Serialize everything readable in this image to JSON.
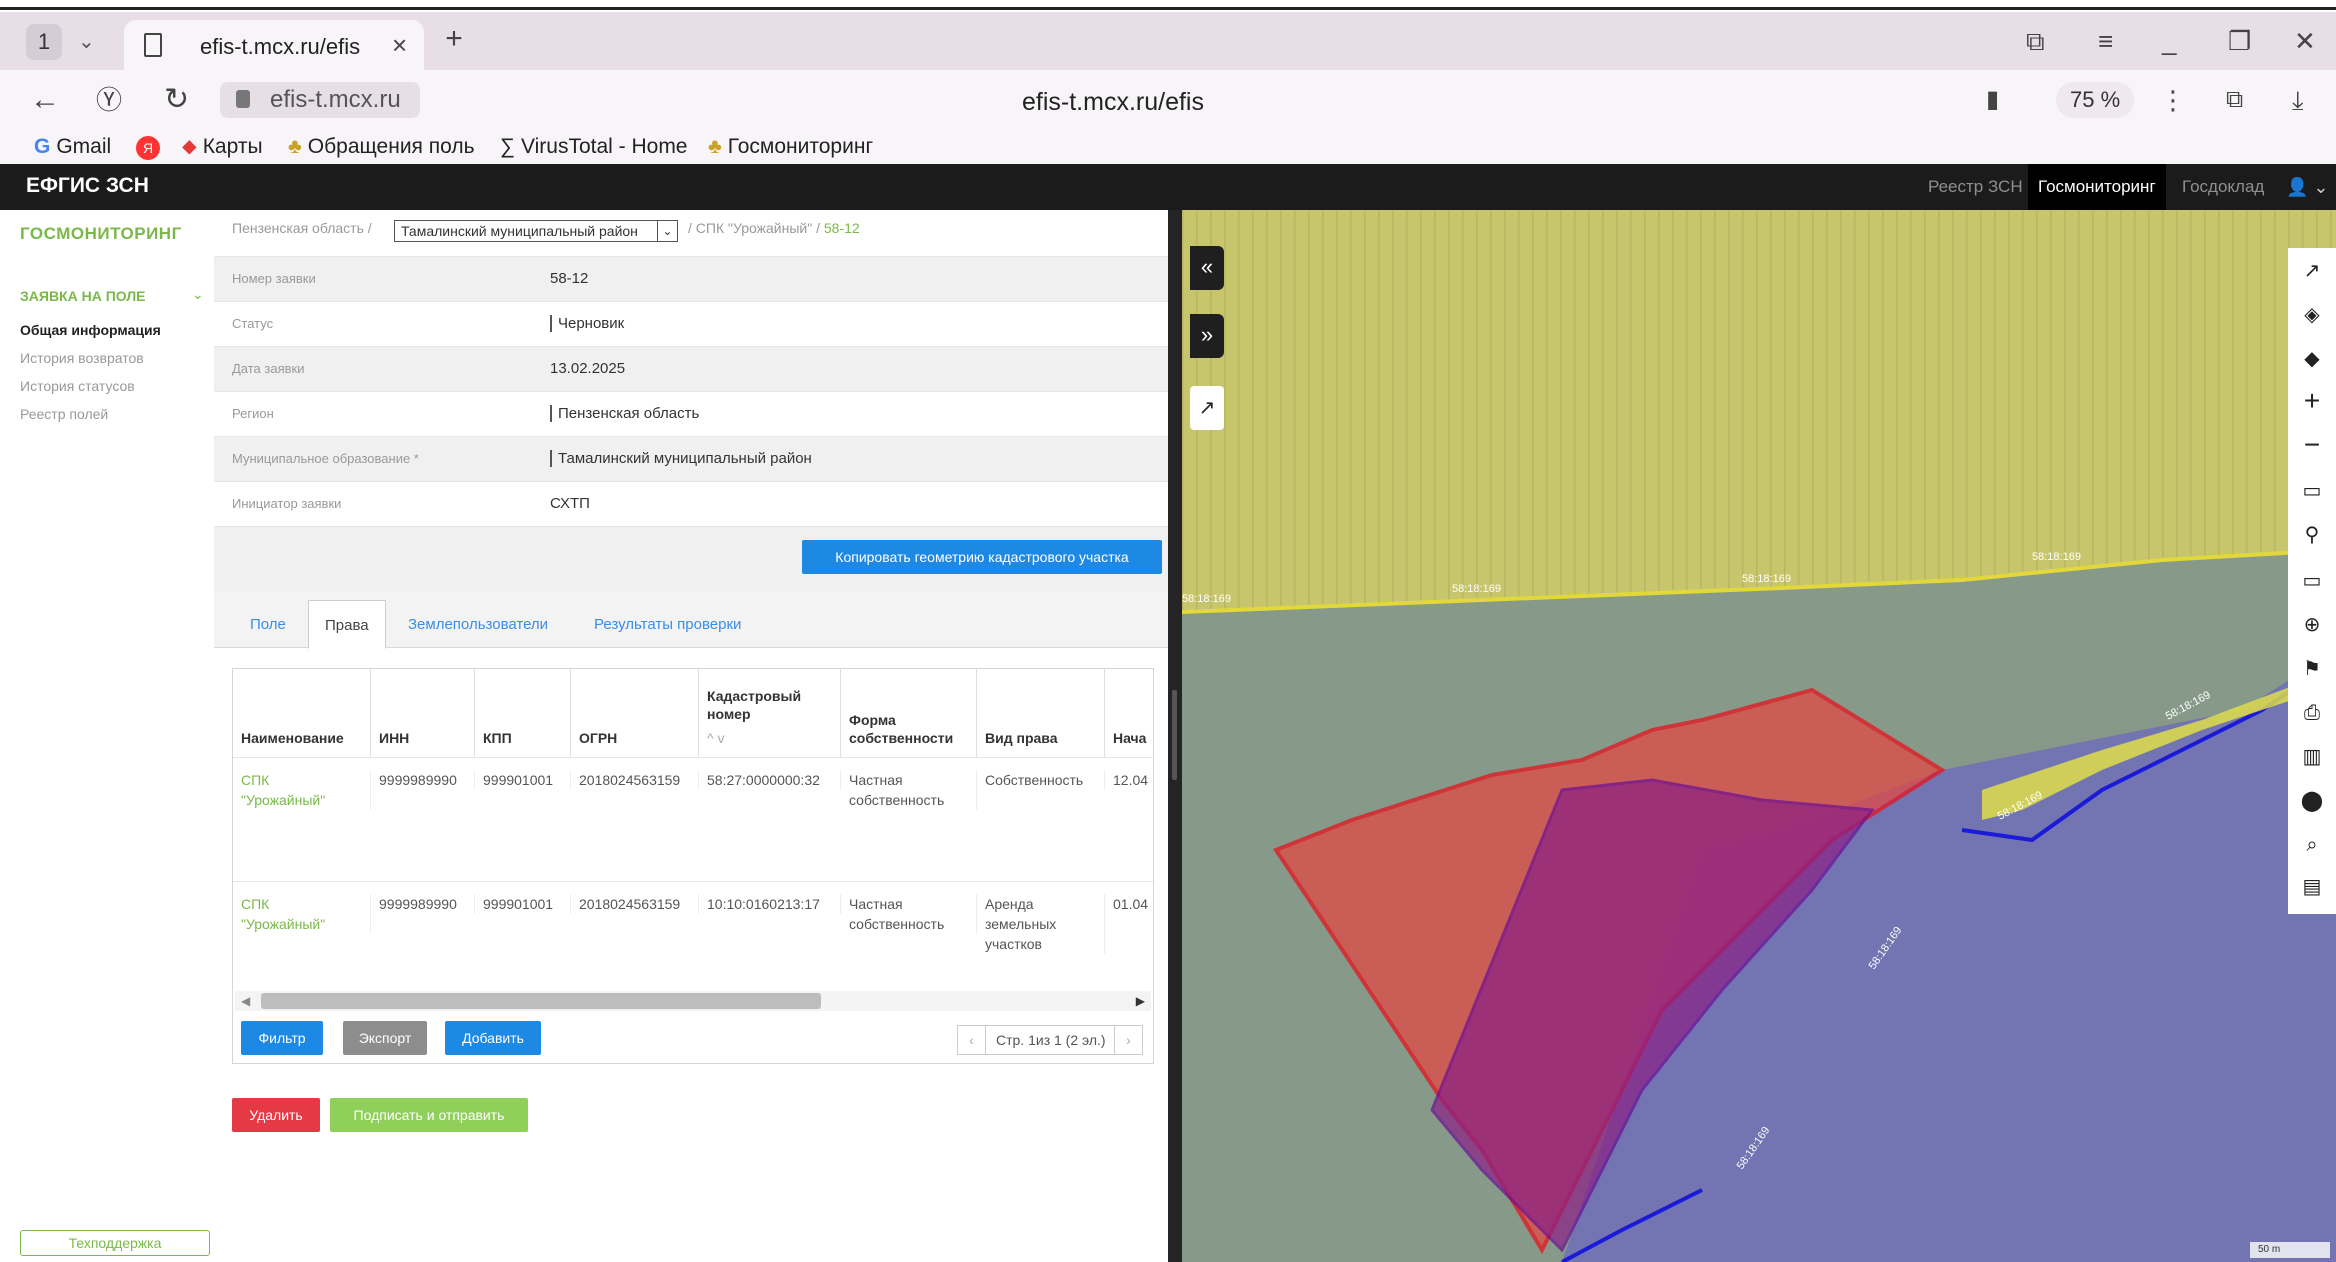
{
  "browser": {
    "tab_count": "1",
    "tab_title": "efis-t.mcx.ru/efis",
    "url_domain": "efis-t.mcx.ru",
    "page_url": "efis-t.mcx.ru/efis",
    "zoom": "75 %",
    "bookmarks": [
      "Gmail",
      "Карты",
      "Обращения поль",
      "VirusTotal - Home",
      "Госмониторинг"
    ]
  },
  "app": {
    "brand": "ЕФГИС ЗСН",
    "nav": [
      "Реестр ЗСН",
      "Госмониторинг",
      "Госдоклад"
    ]
  },
  "sidebar": {
    "title": "ГОСМОНИТОРИНГ",
    "section": "ЗАЯВКА НА ПОЛЕ",
    "items": [
      "Общая информация",
      "История возвратов",
      "История статусов",
      "Реестр полей"
    ],
    "support": "Техподдержка"
  },
  "breadcrumbs": {
    "region": "Пензенская область",
    "district": "Тамалинский муниципальный район",
    "org": "СПК \"Урожайный\"",
    "id": "58-12"
  },
  "form": {
    "fields": [
      {
        "label": "Номер заявки",
        "value": "58-12"
      },
      {
        "label": "Статус",
        "value": "Черновик"
      },
      {
        "label": "Дата заявки",
        "value": "13.02.2025"
      },
      {
        "label": "Регион",
        "value": "Пензенская область"
      },
      {
        "label": "Муниципальное образование  *",
        "value": "Тамалинский муниципальный район"
      },
      {
        "label": "Инициатор заявки",
        "value": "СХТП"
      }
    ],
    "copy_button": "Копировать геометрию кадастрового участка"
  },
  "tabs": [
    "Поле",
    "Права",
    "Землепользователи",
    "Результаты проверки"
  ],
  "grid": {
    "headers": [
      "Наименование",
      "ИНН",
      "КПП",
      "ОГРН",
      "Кадастровый номер",
      "Форма собственности",
      "Вид права",
      "Нача"
    ],
    "sort_arrows": "^  v",
    "rows": [
      {
        "name_1": "СПК",
        "name_2": "\"Урожайный\"",
        "inn": "9999989990",
        "kpp": "999901001",
        "ogrn": "2018024563159",
        "cadastral": "58:27:0000000:32",
        "own_1": "Частная",
        "own_2": "собственность",
        "right_1": "Собственность",
        "right_2": "",
        "right_3": "",
        "start": "12.04"
      },
      {
        "name_1": "СПК",
        "name_2": "\"Урожайный\"",
        "inn": "9999989990",
        "kpp": "999901001",
        "ogrn": "2018024563159",
        "cadastral": "10:10:0160213:17",
        "own_1": "Частная",
        "own_2": "собственность",
        "right_1": "Аренда",
        "right_2": "земельных",
        "right_3": "участков",
        "start": "01.04"
      }
    ],
    "buttons": {
      "filter": "Фильтр",
      "export": "Экспорт",
      "add": "Добавить"
    },
    "pager": "Стр. 1из 1 (2 эл.)"
  },
  "actions": {
    "delete": "Удалить",
    "sign_send": "Подписать и отправить"
  },
  "map": {
    "labels": [
      "58:18:169",
      "58:18:169",
      "58:18:169",
      "58:18:169",
      "58:18:169",
      "58:18:169",
      "58:18:169",
      "58:18:169"
    ],
    "scale": "50 m"
  },
  "colors": {
    "accent_green": "#7ab84a",
    "primary_blue": "#1e88e5",
    "danger_red": "#e53945",
    "header_dark": "#1b1b1b"
  }
}
